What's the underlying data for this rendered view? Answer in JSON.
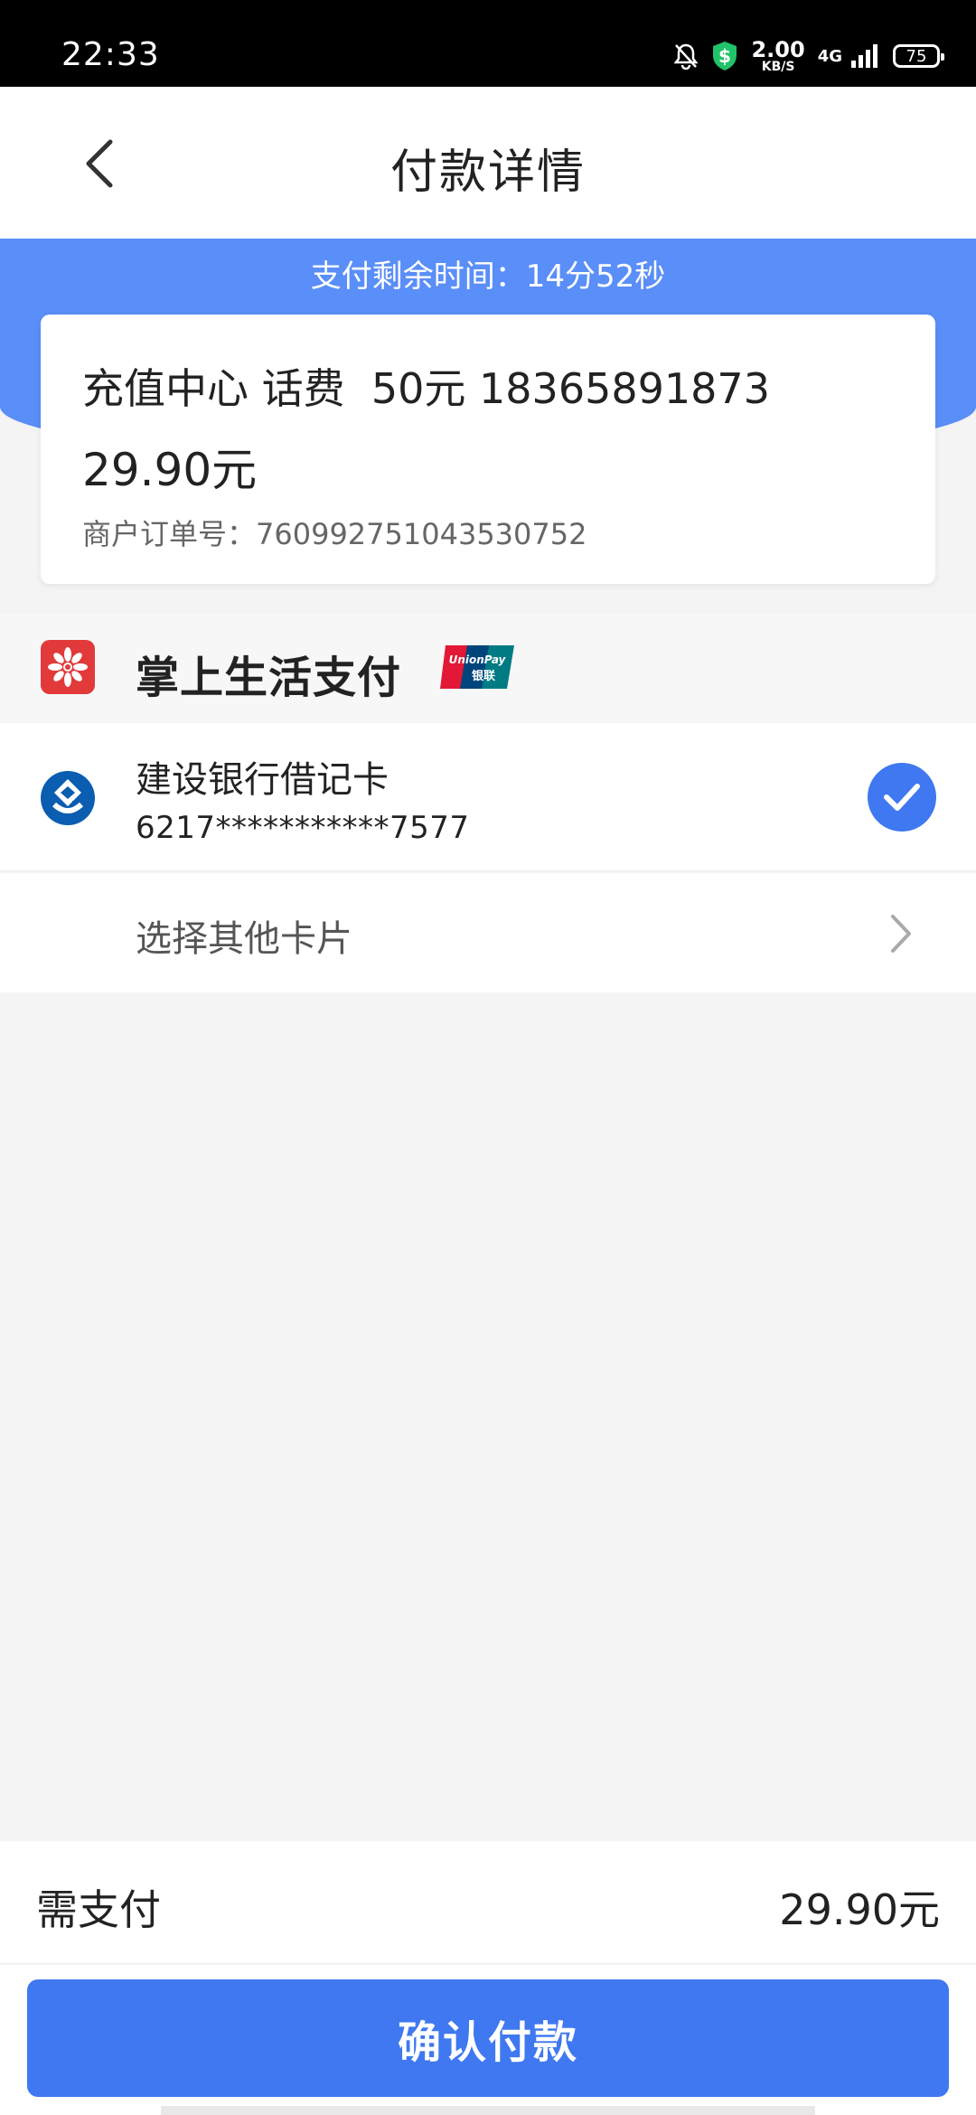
{
  "status_bar": {
    "time": "22:33",
    "speed_value": "2.00",
    "speed_unit": "KB/S",
    "network": "4G",
    "battery": "75"
  },
  "header": {
    "title": "付款详情"
  },
  "timer": {
    "text": "支付剩余时间：14分52秒"
  },
  "order": {
    "title": "充值中心 话费  50元 18365891873",
    "amount": "29.90元",
    "order_no": "商户订单号：760992751043530752"
  },
  "payment_method": {
    "name": "掌上生活支付",
    "badge_top": "UnionPay",
    "badge_bottom": "银联"
  },
  "card": {
    "bank_name": "建设银行借记卡",
    "card_number": "6217***********7577",
    "selected": true
  },
  "other_cards": {
    "label": "选择其他卡片"
  },
  "summary": {
    "label": "需支付",
    "amount": "29.90元"
  },
  "confirm": {
    "label": "确认付款"
  },
  "colors": {
    "primary": "#3f78f0",
    "band": "#5a8ef8",
    "background": "#f4f4f5"
  }
}
